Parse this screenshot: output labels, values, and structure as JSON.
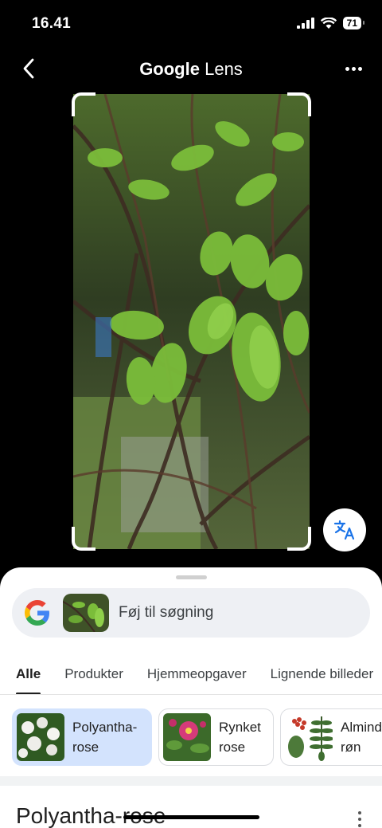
{
  "status_bar": {
    "time": "16.41",
    "battery": "71"
  },
  "header": {
    "title_brand": "Google",
    "title_product": "Lens"
  },
  "search": {
    "text": "Føj til søgning"
  },
  "tabs": [
    {
      "label": "Alle",
      "active": true
    },
    {
      "label": "Produkter",
      "active": false
    },
    {
      "label": "Hjemmeopgaver",
      "active": false
    },
    {
      "label": "Lignende billeder",
      "active": false
    }
  ],
  "chips": [
    {
      "label": "Polyantha-rose",
      "selected": true
    },
    {
      "label": "Rynket rose",
      "selected": false
    },
    {
      "label": "Almindelig røn",
      "selected": false
    }
  ],
  "result": {
    "title": "Polyantha-rose"
  },
  "colors": {
    "accent_blue": "#1a73e8",
    "chip_selected": "#d3e3fd"
  },
  "icons": {
    "back": "chevron-left-icon",
    "more": "more-horizontal-icon",
    "translate": "translate-icon",
    "google": "google-g-icon"
  }
}
